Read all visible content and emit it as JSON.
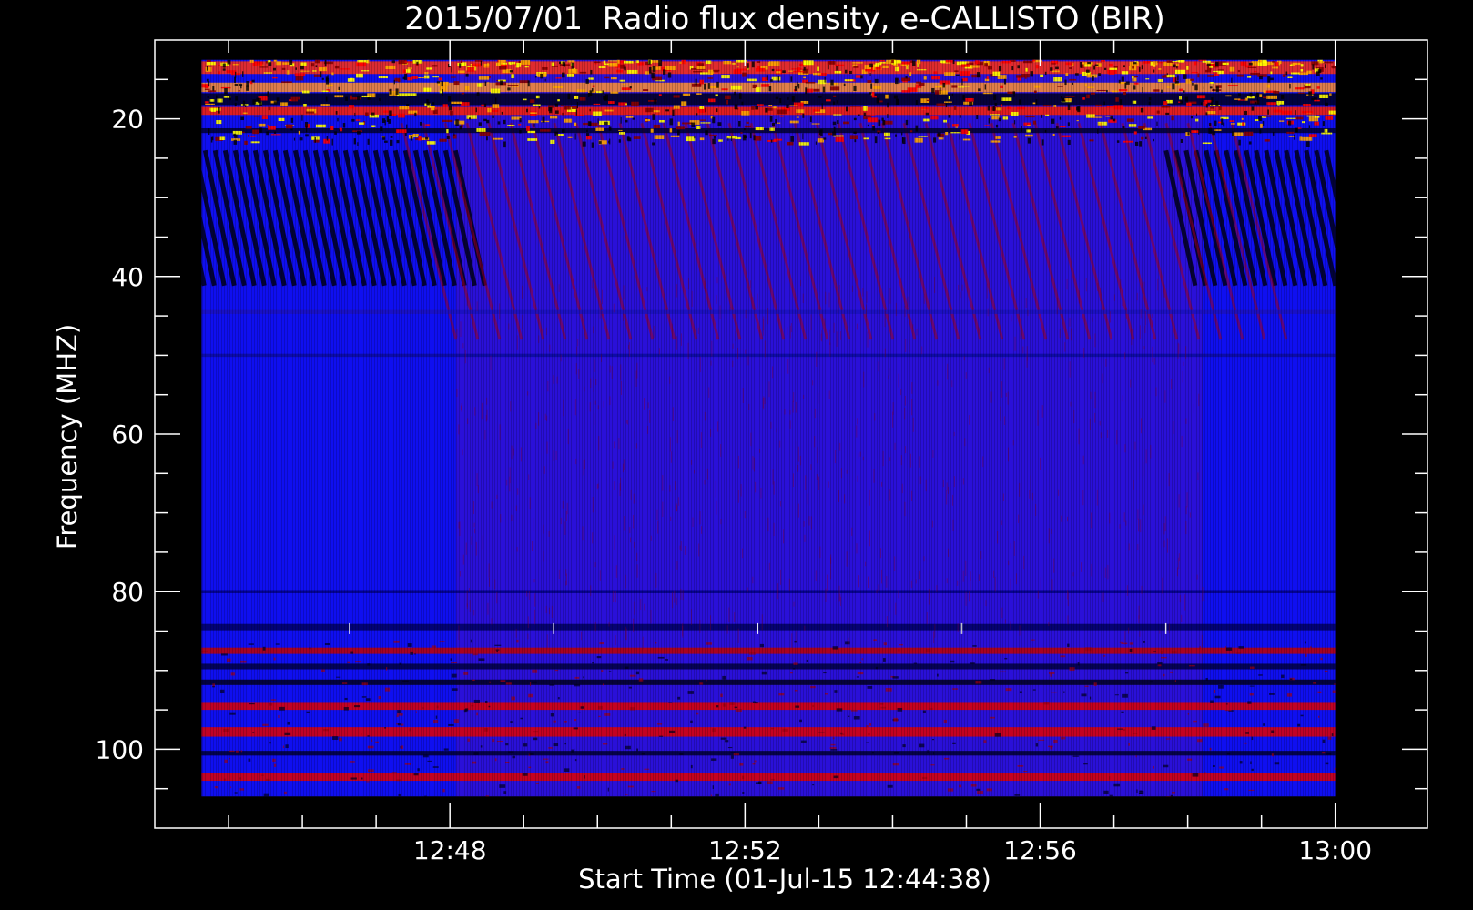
{
  "chart_data": {
    "type": "heatmap",
    "title": "2015/07/01  Radio flux density, e-CALLISTO (BIR)",
    "xlabel": "Start Time (01-Jul-15 12:44:38)",
    "ylabel": "Frequency (MHZ)",
    "x_start": "12:44:38",
    "x_end": "13:00:00",
    "xlim": [
      "12:44:00",
      "13:01:15"
    ],
    "x_tick_labels": [
      "12:48",
      "12:52",
      "12:56",
      "13:00"
    ],
    "x_tick_values": [
      "12:48",
      "12:52",
      "12:56",
      "13:00"
    ],
    "x_minor_ticks": [
      "12:45",
      "12:46",
      "12:47",
      "12:49",
      "12:50",
      "12:51",
      "12:53",
      "12:54",
      "12:55",
      "12:57",
      "12:58",
      "12:59"
    ],
    "ylim": [
      10,
      110
    ],
    "y_axis_inverted": true,
    "y_tick_values": [
      20,
      40,
      60,
      80,
      100
    ],
    "y_tick_labels": [
      "20",
      "40",
      "60",
      "80",
      "100"
    ],
    "y_minor_ticks": [
      15,
      25,
      30,
      35,
      45,
      50,
      55,
      65,
      70,
      75,
      85,
      90,
      95,
      105
    ],
    "data_freq_range": [
      12.5,
      106
    ],
    "colormap": [
      "#000000",
      "#0000ff",
      "#8b0000",
      "#ff0000",
      "#ffa500",
      "#ffff00",
      "#ffffff"
    ],
    "background_color": "#1010ee",
    "plot_background": "#000000",
    "axis_color": "#ffffff",
    "segments": [
      {
        "start": "12:44:38",
        "end": "12:48:05",
        "background": "#0f0ff0"
      },
      {
        "start": "12:48:05",
        "end": "12:58:12",
        "background": "#2a10d8"
      },
      {
        "start": "12:58:12",
        "end": "13:00:00",
        "background": "#0f0ff0"
      }
    ],
    "bursts": {
      "freq_range": [
        24,
        40
      ],
      "direction": "drifting to lower frequency over time",
      "colors": [
        "#000018",
        "#a00020"
      ]
    },
    "bands": [
      {
        "freq": 13.5,
        "color": "#ff3010",
        "thickness": 1.6
      },
      {
        "freq": 16.0,
        "color": "#ff9030",
        "thickness": 1.2
      },
      {
        "freq": 17.5,
        "color": "#000020",
        "thickness": 1.5
      },
      {
        "freq": 19.0,
        "color": "#ff2000",
        "thickness": 1.0
      },
      {
        "freq": 21.5,
        "color": "#000030",
        "thickness": 0.6
      },
      {
        "freq": 44.5,
        "color": "#1a10c0",
        "thickness": 0.5
      },
      {
        "freq": 50.0,
        "color": "#0a0aa0",
        "thickness": 0.4
      },
      {
        "freq": 80.0,
        "color": "#000080",
        "thickness": 0.4
      },
      {
        "freq": 84.5,
        "color": "#000060",
        "thickness": 0.8
      },
      {
        "freq": 87.5,
        "color": "#c00000",
        "thickness": 0.8
      },
      {
        "freq": 89.5,
        "color": "#000040",
        "thickness": 0.7
      },
      {
        "freq": 91.5,
        "color": "#000020",
        "thickness": 0.7
      },
      {
        "freq": 94.5,
        "color": "#e00000",
        "thickness": 1.0
      },
      {
        "freq": 97.8,
        "color": "#e00000",
        "thickness": 1.2
      },
      {
        "freq": 100.5,
        "color": "#000030",
        "thickness": 0.6
      },
      {
        "freq": 103.5,
        "color": "#e00000",
        "thickness": 1.0
      }
    ]
  }
}
